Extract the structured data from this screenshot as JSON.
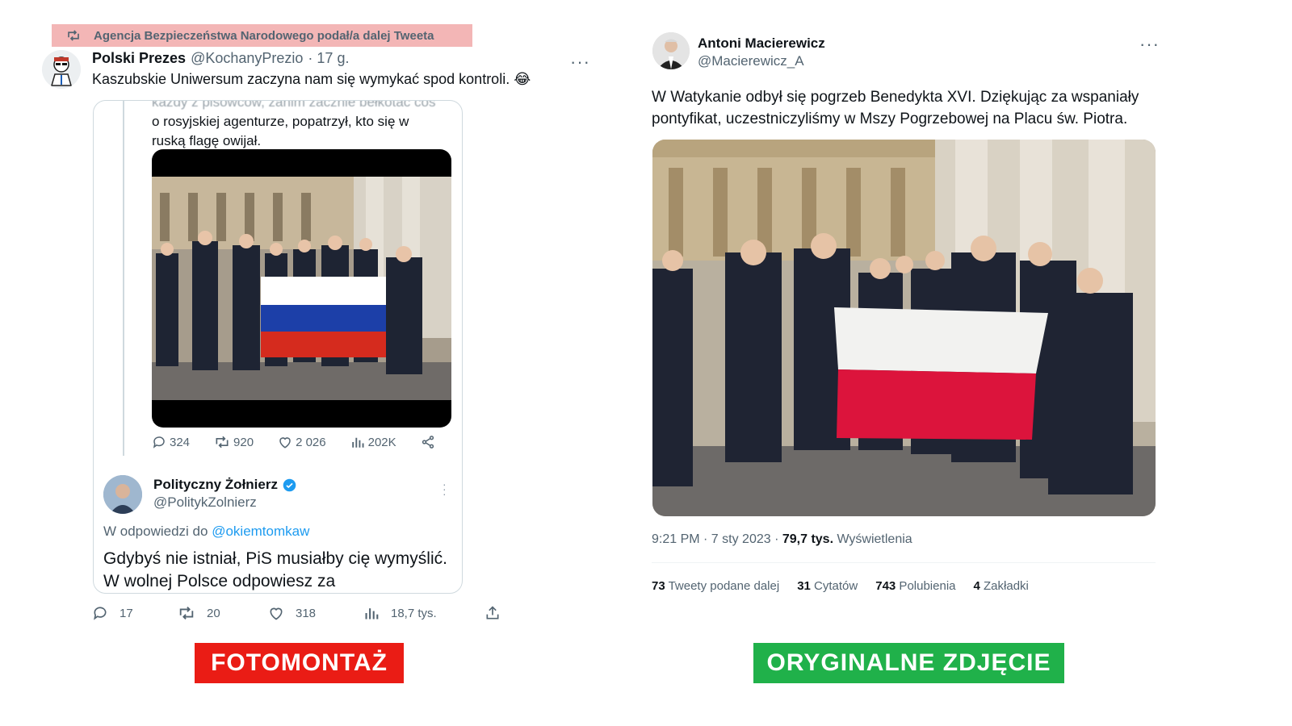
{
  "left_tweet": {
    "retweet_banner": "Agencja Bezpieczeństwa Narodowego podał/a dalej Tweeta",
    "author_name": "Polski Prezes",
    "author_handle": "@KochanyPrezio",
    "time": "· 17 g.",
    "text": "Kaszubskie Uniwersum zaczyna nam się wymykać spod kontroli. 😂",
    "more_icon": "more-dots-icon",
    "quoted": {
      "cut_text_lines": [
        "o rosyjskiej agenturze, popatrzył, kto się w",
        "ruską flagę owijał."
      ],
      "photo_alt": "",
      "actions": {
        "replies": "324",
        "retweets": "920",
        "likes": "2 026",
        "views": "202K"
      },
      "reply_author_name": "Polityczny Żołnierz",
      "reply_author_handle": "@PolitykZolnierz",
      "reply_to_label": "W odpowiedzi do",
      "reply_to_handle": "@okiemtomkaw",
      "reply_text": "Gdybyś nie istniał, PiS musiałby cię wymyślić. W wolnej Polsce odpowiesz za"
    },
    "actions": {
      "replies": "17",
      "retweets": "20",
      "likes": "318",
      "views": "18,7 tys."
    }
  },
  "right_tweet": {
    "author_name": "Antoni Macierewicz",
    "author_handle": "@Macierewicz_A",
    "text": "W Watykanie odbył się pogrzeb Benedykta XVI. Dziękując za wspaniały pontyfikat, uczestniczyliśmy w Mszy Pogrzebowej na Placu św. Piotra.",
    "meta_time": "9:21 PM · 7 sty 2023 · ",
    "meta_views_value": "79,7 tys.",
    "meta_views_label": " Wyświetlenia",
    "stats": [
      {
        "value": "73",
        "label": " Tweety podane dalej"
      },
      {
        "value": "31",
        "label": " Cytatów"
      },
      {
        "value": "743",
        "label": " Polubienia"
      },
      {
        "value": "4",
        "label": " Zakładki"
      }
    ]
  },
  "labels": {
    "left": "FOTOMONTAŻ",
    "right": "ORYGINALNE ZDJĘCIE"
  },
  "colors": {
    "label_left_bg": "#ea1c15",
    "label_right_bg": "#20b14a",
    "retweet_banner_bg": "#f3b6b6",
    "link": "#1d9bf0",
    "verified": "#1d9bf0",
    "flag_russia": [
      "#ffffff",
      "#1c3fa8",
      "#d52b1e"
    ],
    "flag_poland": [
      "#ffffff",
      "#dc143c"
    ]
  }
}
